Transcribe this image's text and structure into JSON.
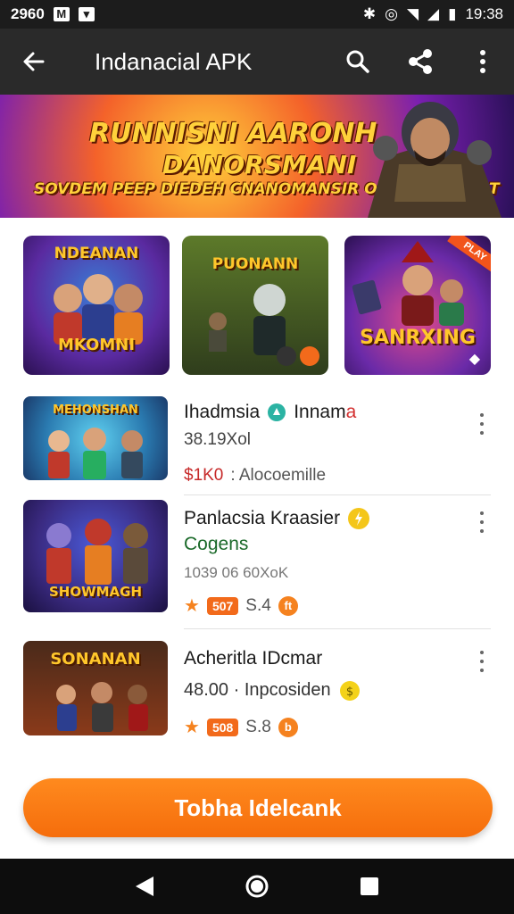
{
  "status_bar": {
    "time_left": "2960",
    "time_right": "19:38"
  },
  "app_bar": {
    "title": "Indanacial APK"
  },
  "banner": {
    "line1": "RUNNISNI AARONH",
    "line2": "DANORSMANI",
    "line3": "SOVDEM PEEP DIEDEH CNANOMANSIR ORERVEADALAT"
  },
  "tiles": [
    {
      "title": "NDEANAN",
      "title2": "MKOMNI"
    },
    {
      "title": "PUONANN"
    },
    {
      "title": "SANRXING",
      "tag": "PLAY"
    }
  ],
  "list": [
    {
      "name_a": "Ihadmsia",
      "name_b": "Innam",
      "name_c": "a",
      "sub": "38.19Xol",
      "price": "$1K0",
      "meta_text": ": Alocoemille",
      "thumb_title": "MEHONSHAN"
    },
    {
      "name": "Panlacsia Kraasier",
      "sub": "Cogens",
      "line3": "1039 06 60XoK",
      "badge": "507",
      "score": "S.4",
      "coin": "ft",
      "thumb_title": "SHOWMAGH"
    },
    {
      "name": "Acheritla IDcmar",
      "sub": "48.00 · Inpcosiden",
      "badge": "508",
      "score": "S.8",
      "coin": "b",
      "thumb_title": "SONANAN"
    }
  ],
  "cta": {
    "label": "Tobha Idelcank"
  },
  "colors": {
    "accent": "#f5821f",
    "appbar": "#2a2a2a",
    "statusbar": "#1c1c1c"
  }
}
